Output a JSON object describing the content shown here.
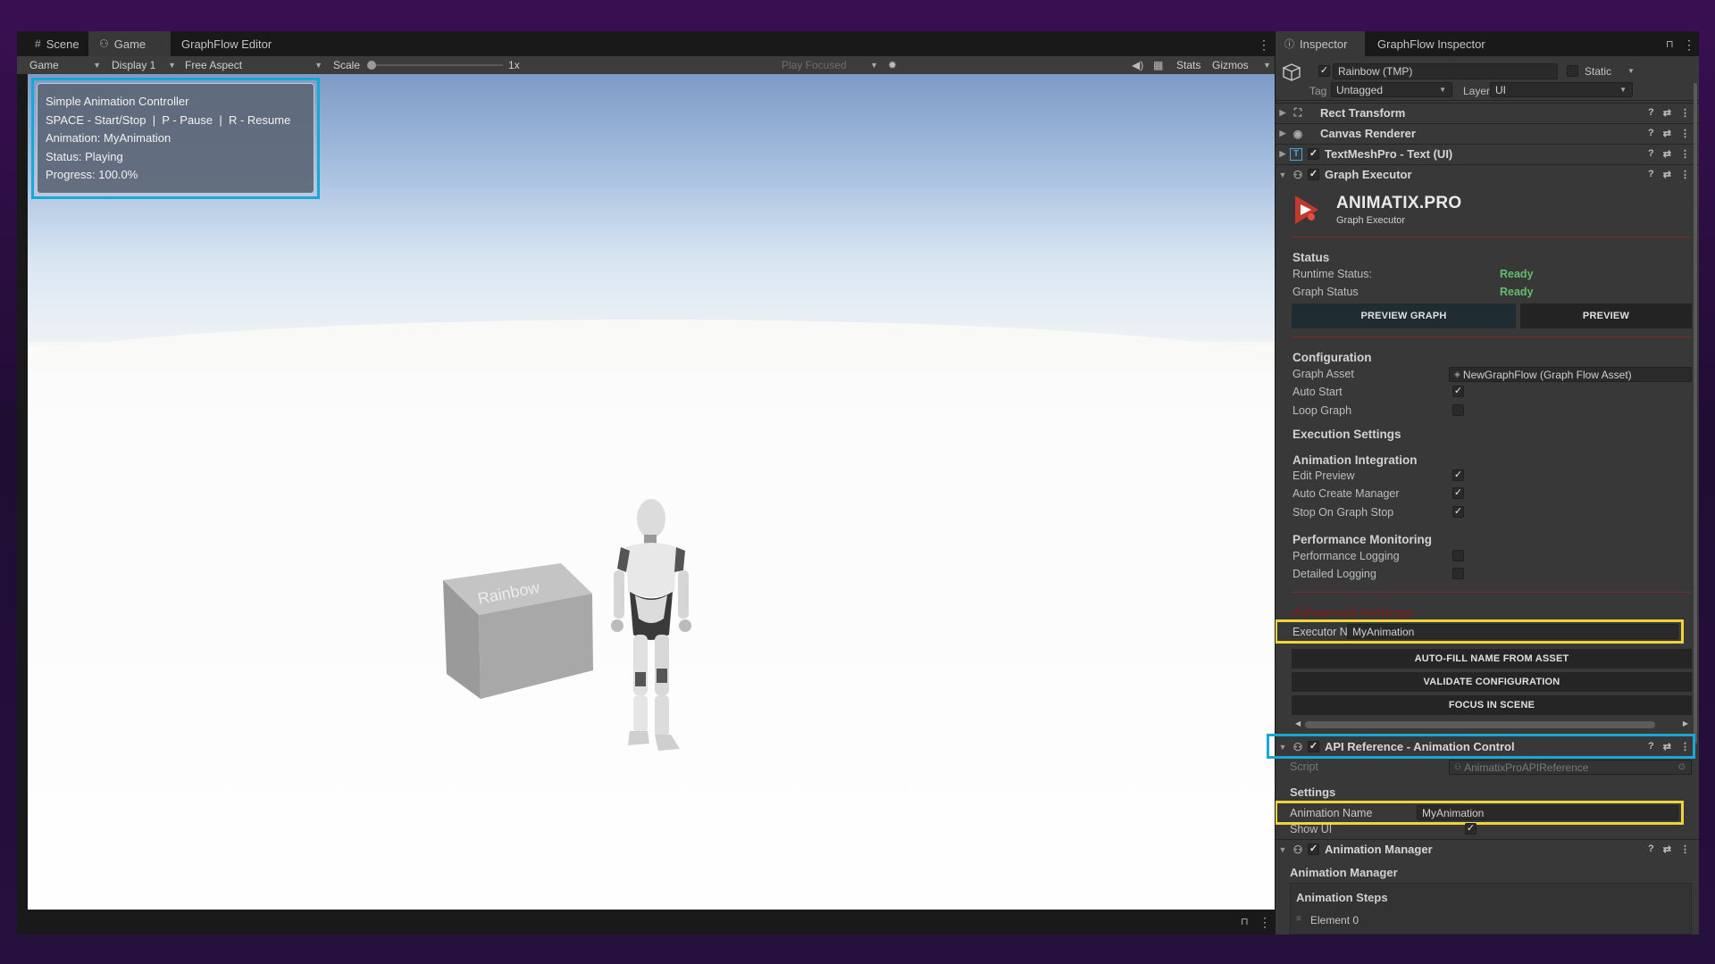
{
  "left_tabs": [
    {
      "label": "Scene",
      "icon": "grid-icon"
    },
    {
      "label": "Game",
      "icon": "gamepad-icon"
    },
    {
      "label": "GraphFlow Editor",
      "icon": ""
    }
  ],
  "game_toolbar": {
    "display_mode": "Game",
    "display": "Display 1",
    "aspect": "Free Aspect",
    "scale_label": "Scale",
    "scale_value": "1x",
    "play_mode": "Play Focused",
    "stats": "Stats",
    "gizmos": "Gizmos"
  },
  "hud": {
    "title": "Simple Animation Controller",
    "controls": "SPACE - Start/Stop  |  P - Pause  |  R - Resume",
    "animation": "Animation: MyAnimation",
    "status": "Status: Playing",
    "progress": "Progress: 100.0%"
  },
  "scene": {
    "box_text": "Rainbow"
  },
  "inspector_tabs": [
    "Inspector",
    "GraphFlow Inspector"
  ],
  "object": {
    "name": "Rainbow (TMP)",
    "static_label": "Static",
    "tag_label": "Tag",
    "tag_value": "Untagged",
    "layer_label": "Layer",
    "layer_value": "UI"
  },
  "components": {
    "rect_transform": "Rect Transform",
    "canvas_renderer": "Canvas Renderer",
    "textmeshpro": "TextMeshPro - Text (UI)",
    "graph_executor": "Graph Executor",
    "api_reference": "API Reference - Animation Control",
    "animation_manager": "Animation Manager"
  },
  "graph_executor": {
    "brand": "ANIMATIX.PRO",
    "brand_sub": "Graph Executor",
    "status_title": "Status",
    "runtime_status_label": "Runtime Status:",
    "runtime_status_value": "Ready",
    "graph_status_label": "Graph Status",
    "graph_status_value": "Ready",
    "preview_graph_btn": "PREVIEW GRAPH",
    "preview_btn": "PREVIEW",
    "config_title": "Configuration",
    "graph_asset_label": "Graph Asset",
    "graph_asset_value": "NewGraphFlow (Graph Flow Asset)",
    "auto_start_label": "Auto Start",
    "loop_graph_label": "Loop Graph",
    "execution_title": "Execution Settings",
    "anim_integration_title": "Animation Integration",
    "edit_preview_label": "Edit Preview",
    "auto_create_label": "Auto Create Manager",
    "stop_on_stop_label": "Stop On Graph Stop",
    "perf_title": "Performance Monitoring",
    "perf_logging_label": "Performance Logging",
    "detailed_logging_label": "Detailed Logging",
    "advanced_title": "Advanced Settings",
    "executor_name_label": "Executor Na",
    "executor_name_value": "MyAnimation",
    "autofill_btn": "AUTO-FILL NAME FROM ASSET",
    "validate_btn": "VALIDATE CONFIGURATION",
    "focus_btn": "FOCUS IN SCENE"
  },
  "api_reference": {
    "script_label": "Script",
    "script_value": "AnimatixProAPIReference",
    "settings_title": "Settings",
    "anim_name_label": "Animation Name",
    "anim_name_value": "MyAnimation",
    "show_ui_label": "Show UI"
  },
  "animation_manager": {
    "title": "Animation Manager",
    "steps_title": "Animation Steps",
    "element0": "Element 0"
  },
  "colors": {
    "accent_blue": "#1aa7d6",
    "highlight_yellow": "#f0d23b",
    "ready_green": "#5fbf6f"
  }
}
